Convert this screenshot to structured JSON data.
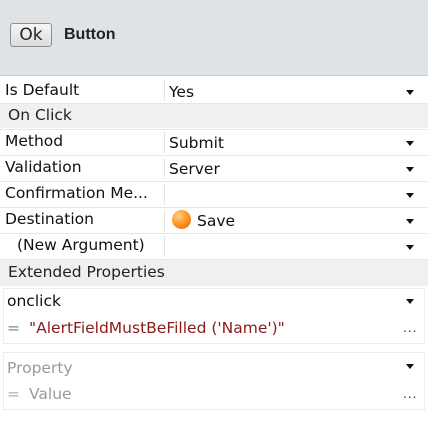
{
  "header": {
    "ok_label": "Ok",
    "title": "Button"
  },
  "properties": {
    "is_default": {
      "name": "Is Default",
      "value": "Yes"
    },
    "on_click_section": "On Click",
    "method": {
      "name": "Method",
      "value": "Submit"
    },
    "validation": {
      "name": "Validation",
      "value": "Server"
    },
    "confirmation": {
      "name": "Confirmation Me...",
      "value": ""
    },
    "destination": {
      "name": "Destination",
      "value": "Save"
    },
    "new_argument": {
      "name": "(New Argument)",
      "value": ""
    },
    "extended_section": "Extended Properties",
    "onclick": {
      "name": "onclick",
      "eq": "=",
      "value": "\"AlertFieldMustBeFilled ('Name')\"",
      "more": "..."
    },
    "new_property": {
      "placeholder_name": "Property",
      "eq": "=",
      "placeholder_value": "Value",
      "more": "..."
    }
  },
  "icons": {
    "dropdown": "chevron-down-icon",
    "destination": "orange-orb-icon"
  }
}
